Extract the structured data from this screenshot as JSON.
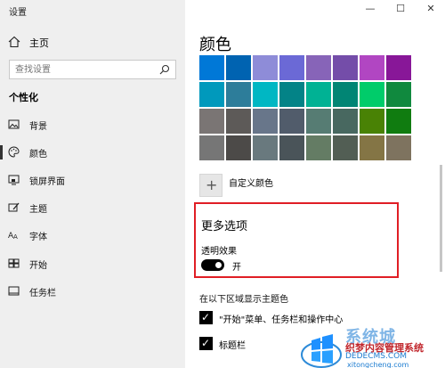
{
  "window": {
    "title": "设置"
  },
  "sidebar": {
    "home_label": "主页",
    "search_placeholder": "查找设置",
    "section_title": "个性化",
    "items": [
      {
        "label": "背景",
        "icon": "image-icon"
      },
      {
        "label": "颜色",
        "icon": "palette-icon",
        "active": true
      },
      {
        "label": "锁屏界面",
        "icon": "lock-screen-icon"
      },
      {
        "label": "主题",
        "icon": "brush-icon"
      },
      {
        "label": "字体",
        "icon": "font-icon"
      },
      {
        "label": "开始",
        "icon": "start-icon"
      },
      {
        "label": "任务栏",
        "icon": "taskbar-icon"
      }
    ]
  },
  "main": {
    "heading": "颜色",
    "swatch_colors": [
      [
        "#0078d7",
        "#0063b1",
        "#8e8cd8",
        "#6b69d6",
        "#8764b8",
        "#744da9",
        "#b146c2",
        "#881798"
      ],
      [
        "#0099bc",
        "#2d7d9a",
        "#00b7c3",
        "#038387",
        "#00b294",
        "#018574",
        "#00cc6a",
        "#10893e"
      ],
      [
        "#7a7574",
        "#5d5a58",
        "#68768a",
        "#515c6b",
        "#567c73",
        "#486860",
        "#498205",
        "#107c10"
      ],
      [
        "#767676",
        "#4c4a48",
        "#69797e",
        "#4a5459",
        "#647c64",
        "#525e54",
        "#847545",
        "#7e735f"
      ]
    ],
    "custom_color_label": "自定义颜色",
    "more_options_title": "更多选项",
    "transparency_label": "透明效果",
    "transparency_state": "开",
    "show_accent_label": "在以下区域显示主题色",
    "checkboxes": [
      {
        "label": "\"开始\"菜单、任务栏和操作中心",
        "checked": true
      },
      {
        "label": "标题栏",
        "checked": true
      }
    ]
  },
  "watermark": {
    "brand": "系统城",
    "line1": "织梦内容管理系统",
    "line2": "DEDECMS.COM",
    "line3": "xitongcheng.com"
  }
}
